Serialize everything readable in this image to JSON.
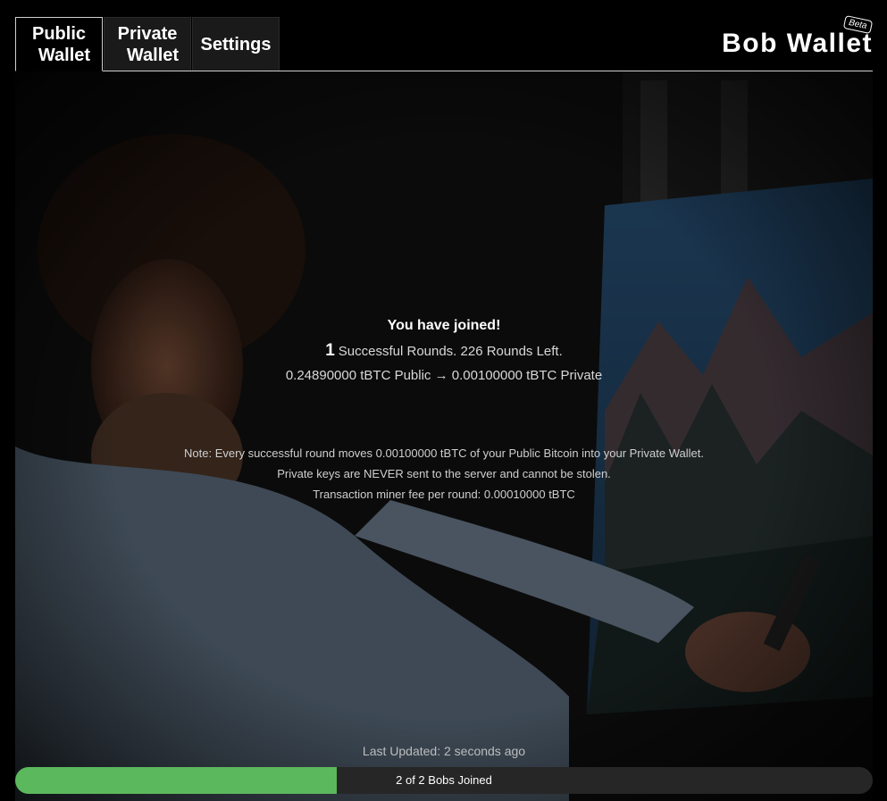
{
  "header": {
    "tabs": [
      {
        "label_line1": "Public",
        "label_line2": "Wallet",
        "active": true
      },
      {
        "label_line1": "Private",
        "label_line2": "Wallet",
        "active": false
      },
      {
        "label": "Settings",
        "active": false
      }
    ],
    "brand": "Bob Wallet",
    "badge": "Beta"
  },
  "status": {
    "joined": "You have joined!",
    "successful_rounds": "1",
    "rounds_text": "Successful Rounds. 226 Rounds Left.",
    "balances": "0.24890000 tBTC Public → 0.00100000 tBTC Private"
  },
  "notes": {
    "line1": "Note: Every successful round moves 0.00100000 tBTC of your Public Bitcoin into your Private Wallet.",
    "line2": "Private keys are NEVER sent to the server and cannot be stolen.",
    "line3": "Transaction miner fee per round: 0.00010000 tBTC"
  },
  "footer": {
    "last_updated": "Last Updated: 2 seconds ago",
    "progress_label": "2 of 2 Bobs Joined",
    "progress_fraction": 0.375
  },
  "colors": {
    "background": "#000000",
    "progress_fill": "#5cb85c",
    "progress_track": "#262626"
  }
}
